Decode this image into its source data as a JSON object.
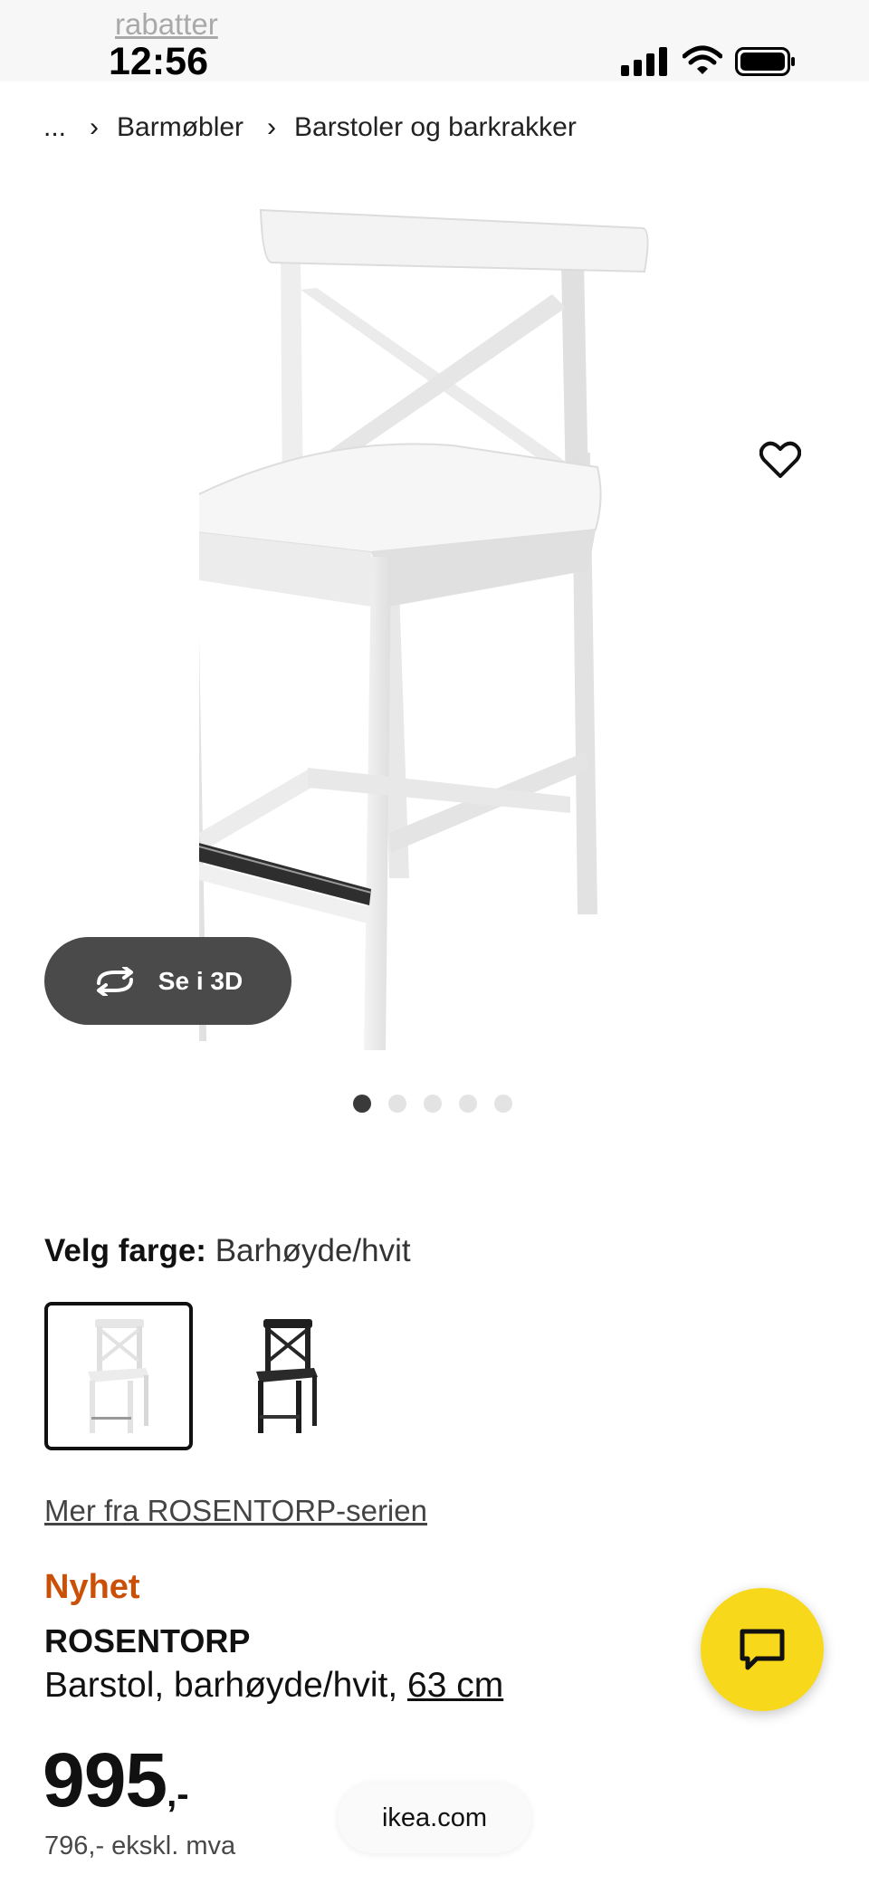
{
  "status_bar": {
    "time": "12:56",
    "overlay_link": "rabatter"
  },
  "breadcrumb": {
    "ellipsis": "...",
    "items": [
      "Barmøbler",
      "Barstoler og barkrakker"
    ]
  },
  "gallery": {
    "view_3d_label": "Se i 3D",
    "image_count": 5,
    "active_index": 0,
    "favorite_icon": "heart-icon"
  },
  "color_picker": {
    "label": "Velg farge:",
    "value": "Barhøyde/hvit",
    "options": [
      {
        "color": "#ffffff",
        "selected": true
      },
      {
        "color": "#222222",
        "selected": false
      }
    ]
  },
  "series_link": "Mer fra ROSENTORP-serien",
  "product": {
    "badge": "Nyhet",
    "name": "ROSENTORP",
    "description": "Barstol, barhøyde/hvit,",
    "dimension": "63 cm",
    "price": "995",
    "price_suffix": ",-",
    "price_excl_vat": "796,- ekskl. mva"
  },
  "browser": {
    "url": "ikea.com"
  },
  "colors": {
    "badge": "#ca5008",
    "chat_button": "#f8d81b",
    "view_3d_button": "#4a4a4a"
  }
}
